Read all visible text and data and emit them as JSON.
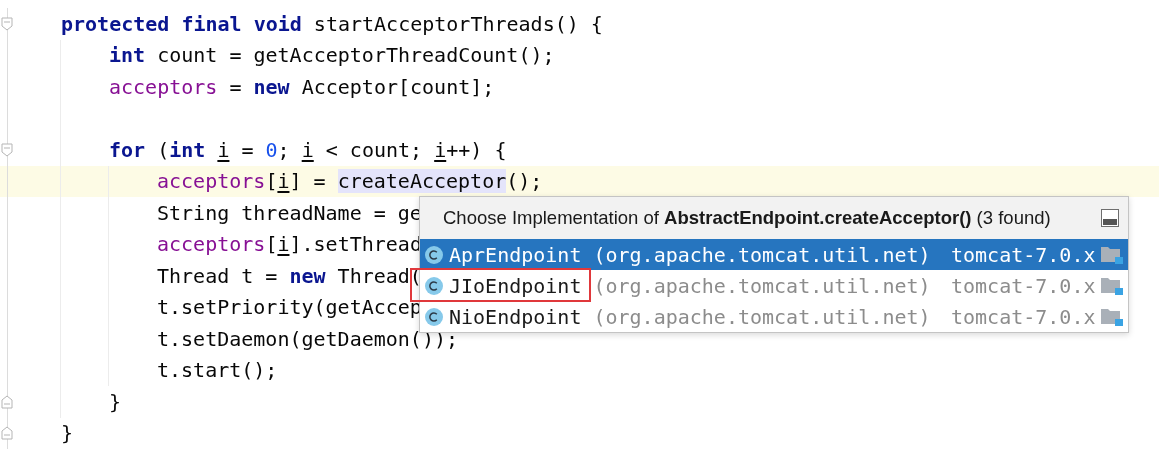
{
  "code": [
    {
      "kind": "block",
      "tokens": [
        {
          "kind": "keyword",
          "text": "protected final void"
        },
        {
          "kind": "plain",
          "text": " startAcceptorThreads() {"
        }
      ],
      "close": "}",
      "children": [
        {
          "kind": "line",
          "tokens": [
            {
              "kind": "keyword",
              "text": "int"
            },
            {
              "kind": "plain",
              "text": " count = getAcceptorThreadCount();"
            }
          ]
        },
        {
          "kind": "line",
          "tokens": [
            {
              "kind": "field",
              "text": "acceptors"
            },
            {
              "kind": "plain",
              "text": " = "
            },
            {
              "kind": "keyword",
              "text": "new"
            },
            {
              "kind": "plain",
              "text": " Acceptor[count];"
            }
          ]
        },
        {
          "kind": "blank"
        },
        {
          "kind": "block",
          "tokens": [
            {
              "kind": "keyword",
              "text": "for"
            },
            {
              "kind": "plain",
              "text": " ("
            },
            {
              "kind": "keyword",
              "text": "int "
            },
            {
              "kind": "var",
              "text": "i"
            },
            {
              "kind": "plain",
              "text": " = "
            },
            {
              "kind": "number",
              "text": "0"
            },
            {
              "kind": "plain",
              "text": "; "
            },
            {
              "kind": "var",
              "text": "i"
            },
            {
              "kind": "plain",
              "text": " < count; "
            },
            {
              "kind": "var",
              "text": "i"
            },
            {
              "kind": "plain",
              "text": "++) {"
            }
          ],
          "close": "}",
          "children": [
            {
              "kind": "line",
              "current": true,
              "tokens": [
                {
                  "kind": "field",
                  "text": "acceptors"
                },
                {
                  "kind": "plain",
                  "text": "["
                },
                {
                  "kind": "var",
                  "text": "i"
                },
                {
                  "kind": "plain",
                  "text": "] = "
                },
                {
                  "kind": "plain",
                  "text": "createAcceptor",
                  "highlighted": true
                },
                {
                  "kind": "plain",
                  "text": "();"
                }
              ]
            },
            {
              "kind": "line",
              "tokens": [
                {
                  "kind": "plain",
                  "text": "String threadName = ge"
                }
              ]
            },
            {
              "kind": "line",
              "tokens": [
                {
                  "kind": "field",
                  "text": "acceptors"
                },
                {
                  "kind": "plain",
                  "text": "["
                },
                {
                  "kind": "var",
                  "text": "i"
                },
                {
                  "kind": "plain",
                  "text": "].setThread"
                }
              ]
            },
            {
              "kind": "line",
              "tokens": [
                {
                  "kind": "plain",
                  "text": "Thread t = "
                },
                {
                  "kind": "keyword",
                  "text": "new"
                },
                {
                  "kind": "plain",
                  "text": " Thread("
                }
              ]
            },
            {
              "kind": "line",
              "tokens": [
                {
                  "kind": "plain",
                  "text": "t.setPriority(getAccep"
                }
              ]
            },
            {
              "kind": "line",
              "tokens": [
                {
                  "kind": "plain",
                  "text": "t.setDaemon(getDaemon());"
                }
              ]
            },
            {
              "kind": "line",
              "tokens": [
                {
                  "kind": "plain",
                  "text": "t.start();"
                }
              ]
            }
          ]
        }
      ]
    }
  ],
  "popup": {
    "title": "Choose Implementation of **AbstractEndpoint.createAcceptor()** (3 found)",
    "items": [
      {
        "name": "AprEndpoint",
        "package": "(org.apache.tomcat.util.net)",
        "module": "tomcat-7.0.x",
        "selected": true,
        "annotated": false
      },
      {
        "name": "JIoEndpoint",
        "package": "(org.apache.tomcat.util.net)",
        "module": "tomcat-7.0.x",
        "selected": false,
        "annotated": true
      },
      {
        "name": "NioEndpoint",
        "package": "(org.apache.tomcat.util.net)",
        "module": "tomcat-7.0.x",
        "selected": false,
        "annotated": false
      }
    ]
  }
}
